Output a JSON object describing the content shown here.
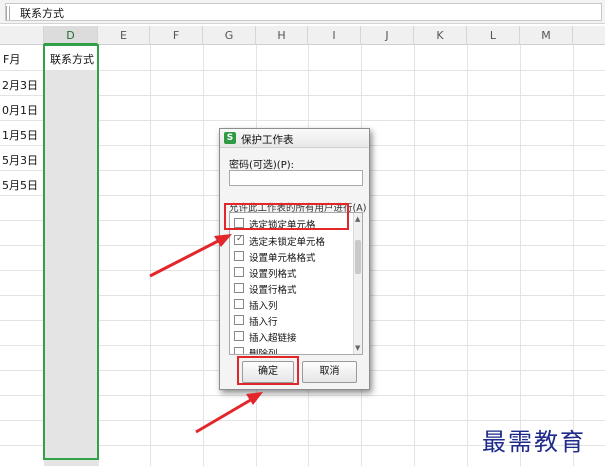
{
  "formula_bar": {
    "content": "联系方式"
  },
  "columns": [
    "D",
    "E",
    "F",
    "G",
    "H",
    "I",
    "J",
    "K",
    "L",
    "M"
  ],
  "active_column": "D",
  "cells": {
    "c_header": "F月",
    "c_r1": "2月3日",
    "c_r2": "0月1日",
    "c_r3": "1月5日",
    "c_r4": "5月3日",
    "c_r5": "5月5日",
    "d_header": "联系方式"
  },
  "dialog": {
    "title": "保护工作表",
    "app_icon_glyph": "S",
    "password_label": "密码(可选)(P):",
    "password_value": "",
    "allow_label": "允许此工作表的所有用户进行(A):",
    "permissions": [
      {
        "label": "选定锁定单元格",
        "checked": false
      },
      {
        "label": "选定未锁定单元格",
        "checked": true
      },
      {
        "label": "设置单元格格式",
        "checked": false
      },
      {
        "label": "设置列格式",
        "checked": false
      },
      {
        "label": "设置行格式",
        "checked": false
      },
      {
        "label": "插入列",
        "checked": false
      },
      {
        "label": "插入行",
        "checked": false
      },
      {
        "label": "插入超链接",
        "checked": false
      },
      {
        "label": "删除列",
        "checked": false
      }
    ],
    "ok_label": "确定",
    "cancel_label": "取消"
  },
  "annotation_color": "#e2262a",
  "selection_color": "#31a24a",
  "watermark": "最需教育"
}
